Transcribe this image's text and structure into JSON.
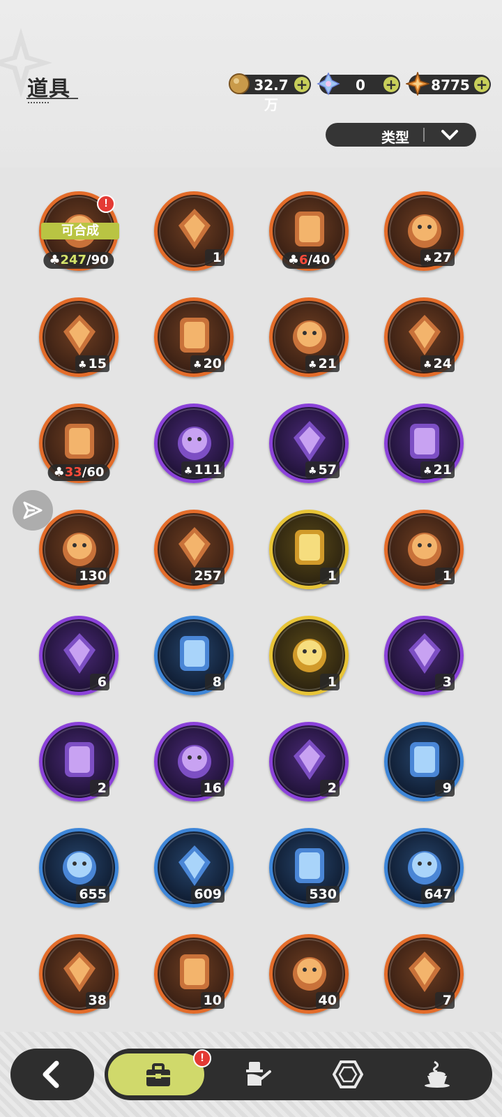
{
  "header": {
    "title": "道具"
  },
  "currencies": [
    {
      "name": "gold-coin",
      "value": "32.7万"
    },
    {
      "name": "crystal",
      "value": "0"
    },
    {
      "name": "star-shard",
      "value": "8775"
    }
  ],
  "filter": {
    "label": "类型"
  },
  "colors": {
    "orange_rarity": "#e36c2a",
    "purple_rarity": "#8b42d9",
    "blue_rarity": "#3e86d8",
    "gold_rarity": "#e7c437",
    "accent": "#d0d96b"
  },
  "items": [
    {
      "icon": "bear-plush-mergeable",
      "rarity": "orange",
      "have": "247",
      "need": "/90",
      "banner": "可合成",
      "alert": true
    },
    {
      "icon": "purple-crystal-emblem",
      "rarity": "orange",
      "count": "1"
    },
    {
      "icon": "mystery-plush",
      "rarity": "orange",
      "have": "6",
      "need": "/40"
    },
    {
      "icon": "teddy-bear-plush",
      "rarity": "orange",
      "count": "27"
    },
    {
      "icon": "knight-plush",
      "rarity": "orange",
      "count": "15"
    },
    {
      "icon": "panda-plush",
      "rarity": "orange",
      "count": "20"
    },
    {
      "icon": "sprout-plush",
      "rarity": "orange",
      "count": "21"
    },
    {
      "icon": "eyepatch-bear-plush",
      "rarity": "orange",
      "count": "24"
    },
    {
      "icon": "bunny-plush",
      "rarity": "orange",
      "have": "33",
      "need": "/60"
    },
    {
      "icon": "clover-plush",
      "rarity": "purple",
      "count": "111"
    },
    {
      "icon": "red-eye-bear-plush",
      "rarity": "purple",
      "count": "57"
    },
    {
      "icon": "yellow-chick-plush",
      "rarity": "purple",
      "count": "21"
    },
    {
      "icon": "pink-star-crystal",
      "rarity": "orange",
      "count": "130"
    },
    {
      "icon": "blue-star-crystal",
      "rarity": "orange",
      "count": "257"
    },
    {
      "icon": "gold-character-card",
      "rarity": "gold",
      "count": "1"
    },
    {
      "icon": "orange-character-card",
      "rarity": "orange",
      "count": "1"
    },
    {
      "icon": "purple-character-card",
      "rarity": "purple",
      "count": "6"
    },
    {
      "icon": "blue-character-card",
      "rarity": "blue",
      "count": "8"
    },
    {
      "icon": "birthday-cake",
      "rarity": "gold",
      "count": "1"
    },
    {
      "icon": "gold-pouch",
      "rarity": "purple",
      "count": "3"
    },
    {
      "icon": "magic-mirror",
      "rarity": "purple",
      "count": "2"
    },
    {
      "icon": "scroll",
      "rarity": "purple",
      "count": "16"
    },
    {
      "icon": "pink-apple",
      "rarity": "purple",
      "count": "2"
    },
    {
      "icon": "envelope-letter",
      "rarity": "blue",
      "count": "9"
    },
    {
      "icon": "shovel",
      "rarity": "blue",
      "count": "655"
    },
    {
      "icon": "glove",
      "rarity": "blue",
      "count": "609"
    },
    {
      "icon": "pickaxe",
      "rarity": "blue",
      "count": "530"
    },
    {
      "icon": "hammer",
      "rarity": "blue",
      "count": "647"
    },
    {
      "icon": "ruby-apple",
      "rarity": "orange",
      "count": "38"
    },
    {
      "icon": "shirt-token",
      "rarity": "orange",
      "count": "10"
    },
    {
      "icon": "wheel-ticket",
      "rarity": "orange",
      "count": "40"
    },
    {
      "icon": "rainbow-ticket",
      "rarity": "orange",
      "count": "7"
    }
  ],
  "nav": {
    "back": "back-icon",
    "tabs": [
      "bag-icon",
      "costume-icon",
      "gem-icon",
      "coffee-icon"
    ],
    "active_tab": 0,
    "bag_alert": "!",
    "item_alert": "!"
  }
}
